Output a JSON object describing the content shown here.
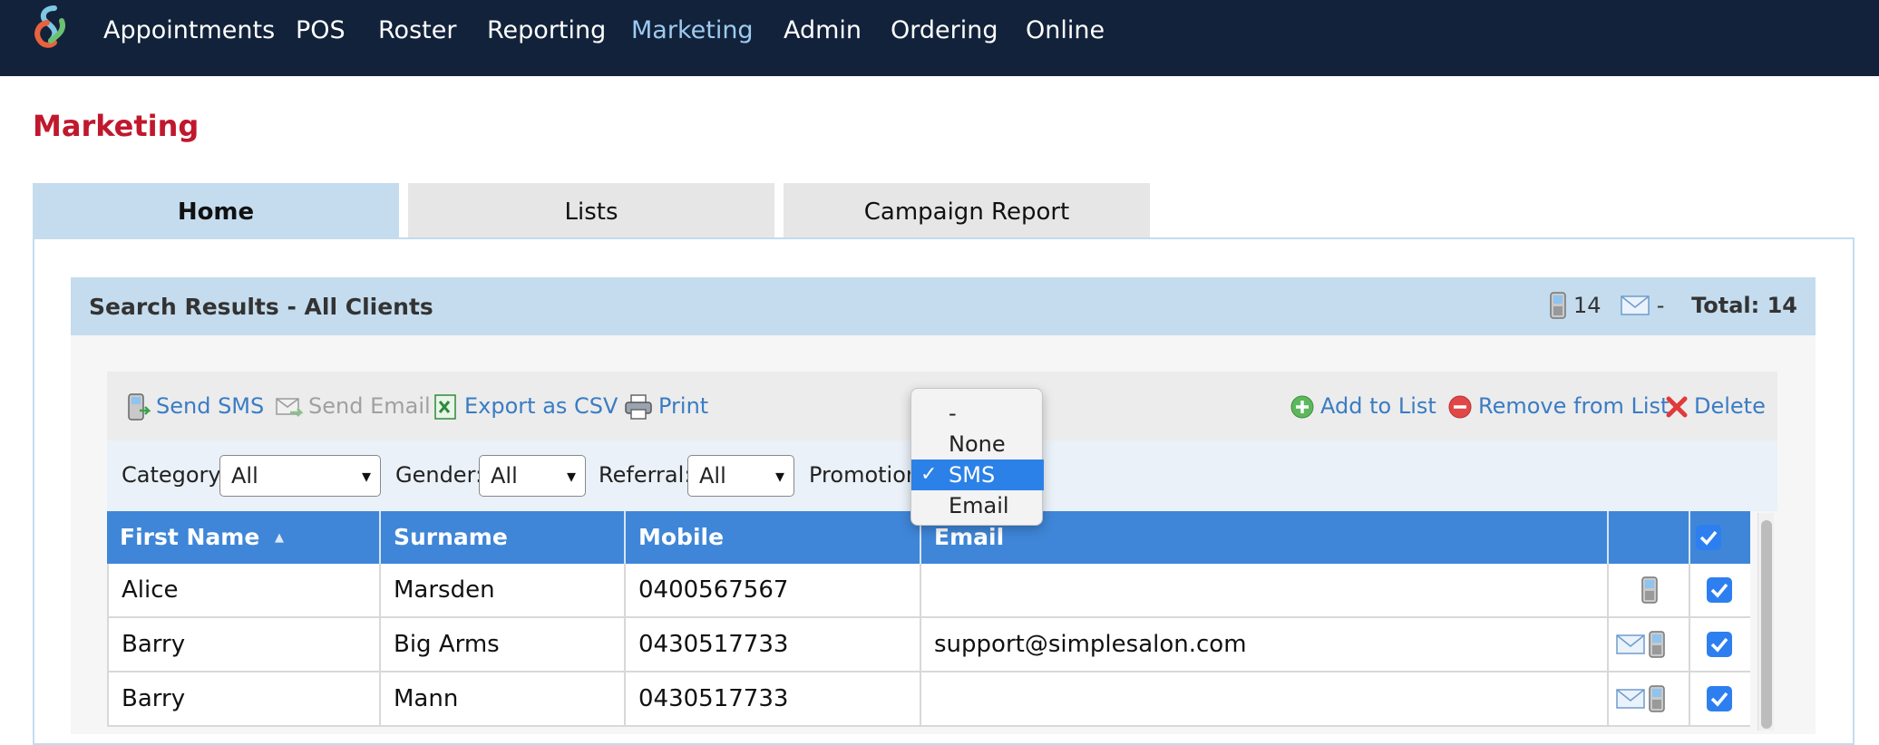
{
  "nav": {
    "items": [
      {
        "label": "Appointments",
        "active": false
      },
      {
        "label": "POS",
        "active": false
      },
      {
        "label": "Roster",
        "active": false
      },
      {
        "label": "Reporting",
        "active": false
      },
      {
        "label": "Marketing",
        "active": true
      },
      {
        "label": "Admin",
        "active": false
      },
      {
        "label": "Ordering",
        "active": false
      },
      {
        "label": "Online",
        "active": false
      }
    ]
  },
  "page": {
    "title": "Marketing"
  },
  "tabs": [
    {
      "label": "Home",
      "active": true
    },
    {
      "label": "Lists",
      "active": false
    },
    {
      "label": "Campaign Report",
      "active": false
    }
  ],
  "results": {
    "title": "Search Results - All Clients",
    "sms_count": "14",
    "email_count": "-",
    "total": "Total: 14"
  },
  "toolbar": {
    "send_sms": "Send SMS",
    "send_email": "Send Email",
    "export_csv": "Export as CSV",
    "print": "Print",
    "add_to_list": "Add to List",
    "remove_from_list": "Remove from List",
    "delete": "Delete"
  },
  "filters": {
    "category_label": "Category:",
    "category_value": "All",
    "gender_label": "Gender:",
    "gender_value": "All",
    "referral_label": "Referral:",
    "referral_value": "All",
    "promotion_label": "Promotion"
  },
  "promotion_dropdown": {
    "options": [
      "-",
      "None",
      "SMS",
      "Email"
    ],
    "selected": "SMS",
    "check_glyph": "✓"
  },
  "table": {
    "columns": {
      "first_name": "First Name",
      "surname": "Surname",
      "mobile": "Mobile",
      "email": "Email"
    },
    "sort_indicator": "▲",
    "rows": [
      {
        "first_name": "Alice",
        "surname": "Marsden",
        "mobile": "0400567567",
        "email": "",
        "has_email": false,
        "has_mobile": true,
        "checked": true
      },
      {
        "first_name": "Barry",
        "surname": "Big Arms",
        "mobile": "0430517733",
        "email": "support@simplesalon.com",
        "has_email": true,
        "has_mobile": true,
        "checked": true
      },
      {
        "first_name": "Barry",
        "surname": "Mann",
        "mobile": "0430517733",
        "email": "",
        "has_email": true,
        "has_mobile": true,
        "checked": true
      }
    ]
  },
  "colors": {
    "navbar": "#12223a",
    "nav_active": "#9ecbf0",
    "title_red": "#c0182d",
    "header_blue": "#3f86d8",
    "light_blue": "#c4dcee",
    "link_blue": "#3a7cc4",
    "checkbox_blue": "#2d7ff0"
  }
}
